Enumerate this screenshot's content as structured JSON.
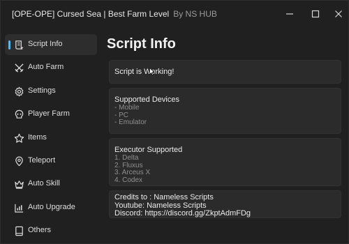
{
  "window": {
    "title": "[OPE-OPE] Cursed Sea | Best Farm Level",
    "author": "By NS HUB",
    "colors": {
      "background": "#202020",
      "card": "#2b2b2b",
      "accent": "#5fb4e8"
    }
  },
  "sidebar": {
    "items": [
      {
        "label": "Script Info",
        "icon": "script-icon",
        "active": true
      },
      {
        "label": "Auto Farm",
        "icon": "crossed-swords-icon"
      },
      {
        "label": "Settings",
        "icon": "gear-icon"
      },
      {
        "label": "Player Farm",
        "icon": "skull-icon"
      },
      {
        "label": "Items",
        "icon": "star-icon"
      },
      {
        "label": "Teleport",
        "icon": "map-pin-icon"
      },
      {
        "label": "Auto Skill",
        "icon": "crown-icon"
      },
      {
        "label": "Auto Upgrade",
        "icon": "bar-chart-icon"
      },
      {
        "label": "Others",
        "icon": "book-icon"
      }
    ]
  },
  "main": {
    "title": "Script Info",
    "status": "Script is Working!",
    "devices": {
      "heading": "Supported Devices",
      "items": [
        "- Mobile",
        "- PC",
        "- Emulator"
      ]
    },
    "executors": {
      "heading": "Executor Supported",
      "items": [
        "1. Delta",
        "2. Fluxus",
        "3. Arceus X",
        "4. Codex"
      ]
    },
    "credits": {
      "lines": [
        "Credits to : Nameless Scripts",
        "Youtube: Nameless Scripts",
        "Discord: https://discord.gg/ZkptAdmFDg"
      ]
    }
  }
}
